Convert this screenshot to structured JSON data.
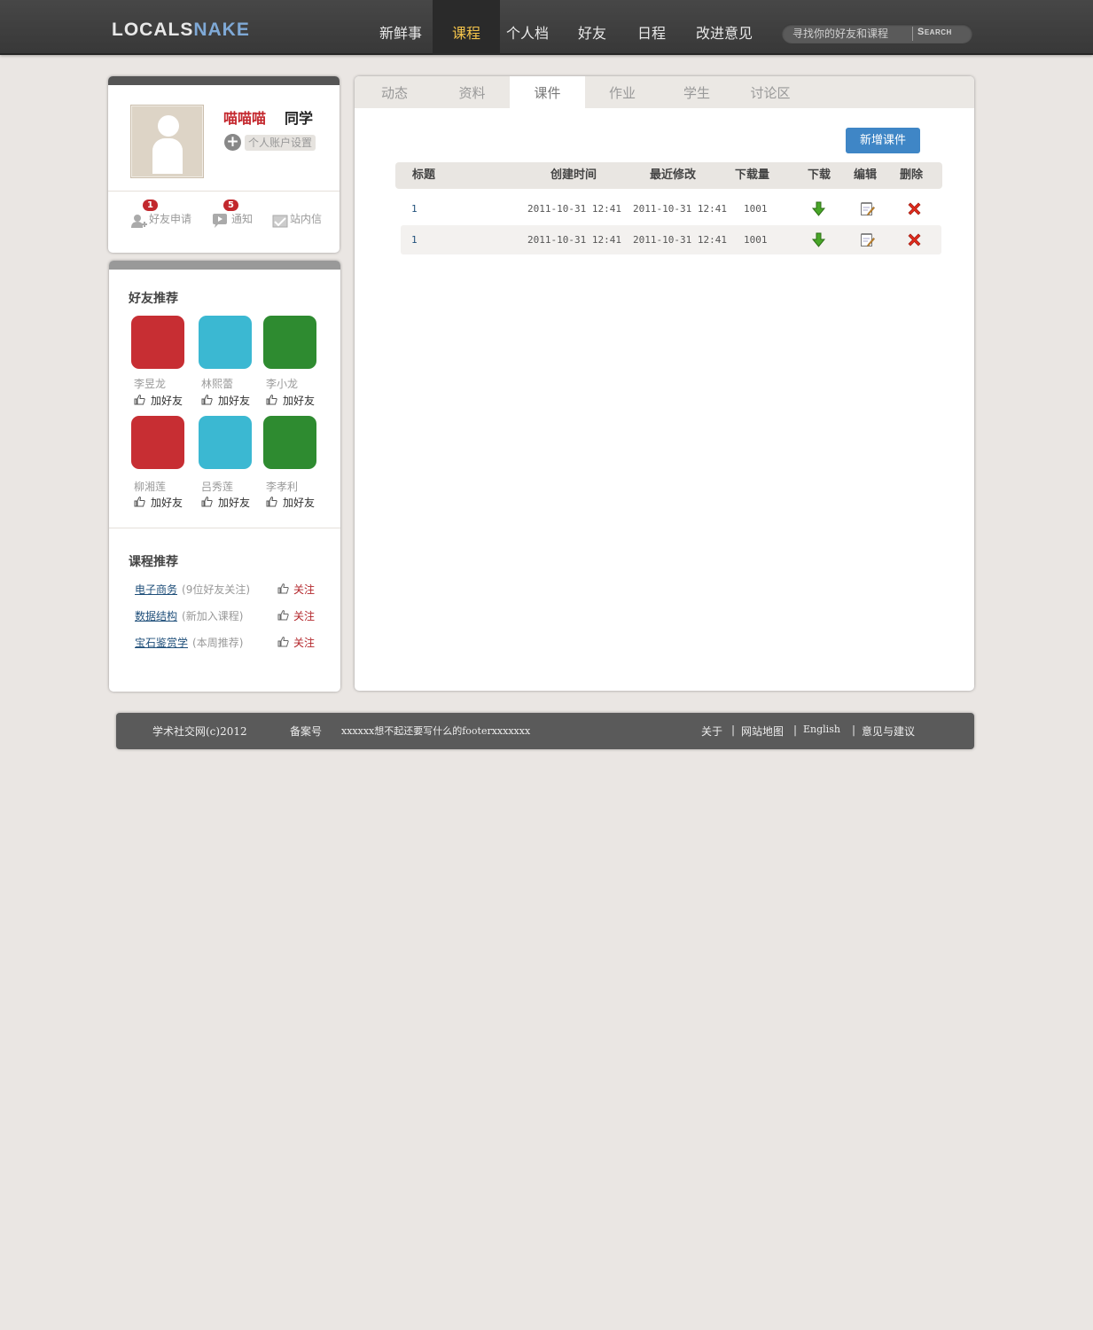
{
  "brand": {
    "logo_a": "LOCALS",
    "logo_b": "NAKE"
  },
  "nav": {
    "items": [
      "新鲜事",
      "课程",
      "个人档",
      "好友",
      "日程",
      "改进意见"
    ],
    "active": "课程"
  },
  "search": {
    "placeholder": "寻找你的好友和课程",
    "button": "Search"
  },
  "profile": {
    "name": "喵喵喵",
    "role": "同学",
    "settings_label": "个人账户设置",
    "quick_links": [
      {
        "label": "好友申请",
        "badge": "1"
      },
      {
        "label": "通知",
        "badge": "5"
      },
      {
        "label": "站内信"
      }
    ]
  },
  "friend_rec": {
    "title": "好友推荐",
    "add_label": "加好友",
    "friends": [
      {
        "name": "李昱龙",
        "color": "#c72e33"
      },
      {
        "name": "林熙蕾",
        "color": "#3bb8d2"
      },
      {
        "name": "李小龙",
        "color": "#2e8b30"
      },
      {
        "name": "柳湘莲",
        "color": "#c72e33"
      },
      {
        "name": "吕秀莲",
        "color": "#3bb8d2"
      },
      {
        "name": "李孝利",
        "color": "#2e8b30"
      }
    ]
  },
  "course_rec": {
    "title": "课程推荐",
    "follow_label": "关注",
    "courses": [
      {
        "name": "电子商务",
        "note": "(9位好友关注)"
      },
      {
        "name": "数据结构",
        "note": "(新加入课程)"
      },
      {
        "name": "宝石鉴赏学",
        "note": "(本周推荐)"
      }
    ]
  },
  "tabs": {
    "items": [
      "动态",
      "资料",
      "课件",
      "作业",
      "学生",
      "讨论区"
    ],
    "active": "课件"
  },
  "courseware": {
    "new_button": "新增课件",
    "columns": [
      "标题",
      "创建时间",
      "最近修改",
      "下载量",
      "下载",
      "编辑",
      "删除"
    ],
    "rows": [
      {
        "title": "1",
        "created": "2011-10-31 12:41",
        "modified": "2011-10-31 12:41",
        "downloads": "1001"
      },
      {
        "title": "1",
        "created": "2011-10-31 12:41",
        "modified": "2011-10-31 12:41",
        "downloads": "1001"
      }
    ]
  },
  "footer": {
    "copyright": "学术社交网(c)2012",
    "record_label": "备案号",
    "placeholder_text": "xxxxxx想不起还要写什么的footerxxxxxxx",
    "links": [
      "关于",
      "网站地图",
      "English",
      "意见与建议"
    ],
    "separator": "|"
  }
}
